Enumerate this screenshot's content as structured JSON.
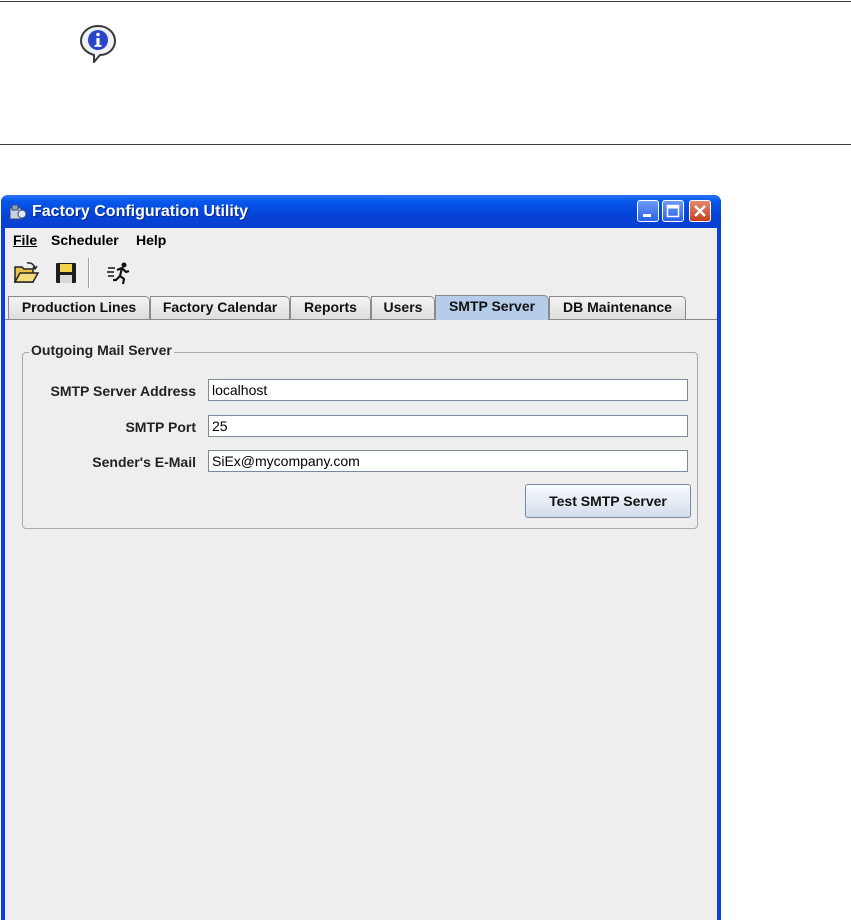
{
  "window": {
    "title": "Factory Configuration Utility"
  },
  "menu": {
    "file": "File",
    "scheduler": "Scheduler",
    "help": "Help"
  },
  "toolbar": {
    "icons": [
      "open-folder-icon",
      "save-floppy-icon",
      "run-icon"
    ]
  },
  "tabs": [
    {
      "label": "Production Lines"
    },
    {
      "label": "Factory Calendar"
    },
    {
      "label": "Reports"
    },
    {
      "label": "Users"
    },
    {
      "label": "SMTP Server",
      "active": true
    },
    {
      "label": "DB Maintenance"
    }
  ],
  "smtp": {
    "group_title": "Outgoing Mail Server",
    "address_label": "SMTP Server Address",
    "address_value": "localhost",
    "port_label": "SMTP Port",
    "port_value": "25",
    "sender_label": "Sender's E-Mail",
    "sender_value": "SiEx@mycompany.com",
    "test_button": "Test SMTP Server"
  },
  "colors": {
    "titlebar": "#0A3EE0",
    "active_tab": "#B6CDEA",
    "panel_bg": "#EEEEEE"
  }
}
